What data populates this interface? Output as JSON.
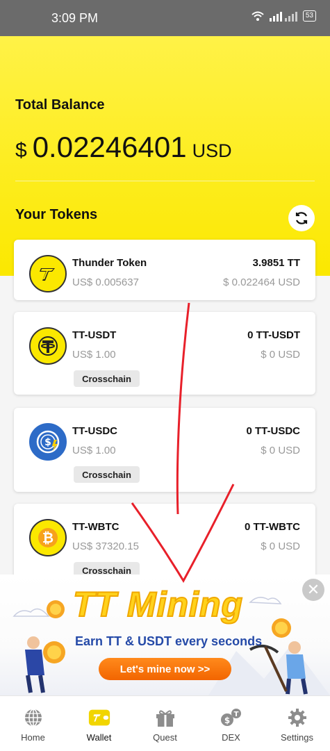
{
  "status": {
    "time": "3:09 PM",
    "battery": "53"
  },
  "header": {
    "total_label": "Total Balance",
    "currency_symbol": "$",
    "balance": "0.02246401",
    "unit": "USD",
    "tokens_title": "Your Tokens"
  },
  "tokens": [
    {
      "name": "Thunder Token",
      "price": "US$ 0.005637",
      "amount": "3.9851 TT",
      "value": "$ 0.022464 USD",
      "icon": "thunder-token-icon"
    },
    {
      "name": "TT-USDT",
      "price": "US$ 1.00",
      "amount": "0 TT-USDT",
      "value": "$ 0 USD",
      "chip": "Crosschain",
      "icon": "tether-icon"
    },
    {
      "name": "TT-USDC",
      "price": "US$ 1.00",
      "amount": "0 TT-USDC",
      "value": "$ 0 USD",
      "chip": "Crosschain",
      "icon": "usdc-icon"
    },
    {
      "name": "TT-WBTC",
      "price": "US$ 37320.15",
      "amount": "0 TT-WBTC",
      "value": "$ 0 USD",
      "chip": "Crosschain",
      "icon": "bitcoin-icon"
    }
  ],
  "banner": {
    "title": "TT Mining",
    "subtitle": "Earn TT & USDT every seconds",
    "button": "Let's mine now >>"
  },
  "tabs": [
    {
      "label": "Home",
      "icon": "globe-icon"
    },
    {
      "label": "Wallet",
      "icon": "wallet-icon",
      "active": true
    },
    {
      "label": "Quest",
      "icon": "gift-icon"
    },
    {
      "label": "DEX",
      "icon": "exchange-icon"
    },
    {
      "label": "Settings",
      "icon": "gear-icon"
    }
  ],
  "colors": {
    "accent": "#fbe800",
    "banner_button": "#f26500",
    "annotation": "#e8202a"
  }
}
